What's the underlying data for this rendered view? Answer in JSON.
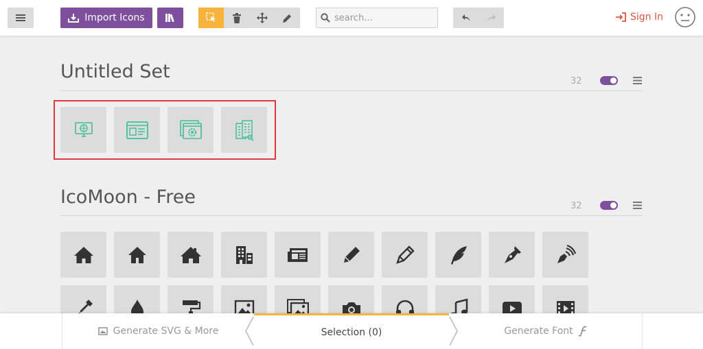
{
  "toolbar": {
    "import_label": "Import Icons",
    "search_placeholder": "search...",
    "sign_in_label": "Sign In"
  },
  "sets": [
    {
      "title": "Untitled Set",
      "count": "32"
    },
    {
      "title": "IcoMoon - Free",
      "count": "32"
    }
  ],
  "footer": {
    "generate_svg": "Generate SVG & More",
    "selection": "Selection (0)",
    "generate_font": "Generate Font"
  },
  "colors": {
    "accent_purple": "#7d4f9c",
    "selection_orange": "#f7b33c",
    "sign_in_red": "#e0533f",
    "icon_green": "#3fbf9a",
    "icon_dark": "#333333"
  },
  "icons": {
    "untitled_set": [
      "monitor-globe-icon",
      "browser-window-icon",
      "browser-gear-icon",
      "building-docs-icon"
    ],
    "icomoon_row1": [
      "home-icon",
      "home2-icon",
      "home3-icon",
      "office-icon",
      "newspaper-icon",
      "pencil-icon",
      "pencil2-icon",
      "quill-icon",
      "pen-icon",
      "blog-icon"
    ],
    "icomoon_row2": [
      "eyedropper-icon",
      "droplet-icon",
      "paint-format-icon",
      "image-icon",
      "images-icon",
      "camera-icon",
      "headphones-icon",
      "music-icon",
      "play-icon",
      "film-icon"
    ]
  }
}
